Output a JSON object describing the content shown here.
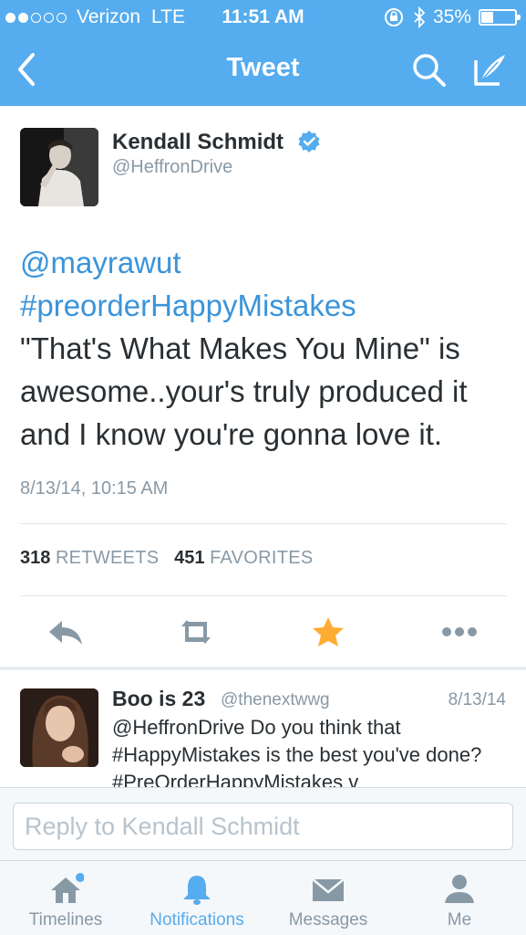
{
  "status_bar": {
    "carrier": "Verizon",
    "network": "LTE",
    "time": "11:51 AM",
    "battery_percent": "35%",
    "battery_level": 0.35,
    "signal_bars_filled": 2,
    "signal_bars_total": 5
  },
  "nav": {
    "title": "Tweet",
    "back_icon": "chevron-left-icon",
    "search_icon": "search-icon",
    "compose_icon": "compose-icon"
  },
  "tweet": {
    "author_name": "Kendall Schmidt",
    "author_handle": "@HeffronDrive",
    "verified": true,
    "mention": "@mayrawut",
    "hashtag": "#preorderHappyMistakes",
    "body": "\"That's What Makes You Mine\" is awesome..your's truly produced it and I know you're gonna love it.",
    "timestamp": "8/13/14, 10:15 AM",
    "retweets_count": "318",
    "retweets_label": "RETWEETS",
    "favorites_count": "451",
    "favorites_label": "FAVORITES"
  },
  "actions": [
    {
      "name": "reply",
      "icon": "reply-icon"
    },
    {
      "name": "retweet",
      "icon": "retweet-icon"
    },
    {
      "name": "favorite",
      "icon": "star-icon",
      "active": true
    },
    {
      "name": "more",
      "icon": "more-icon"
    }
  ],
  "reply": {
    "name": "Boo is 23",
    "handle": "@thenextwwg",
    "date": "8/13/14",
    "text": "@HeffronDrive Do you think that #HappyMistakes is the best you've done? #PreOrderHappyMistakes v"
  },
  "reply_box": {
    "placeholder": "Reply to Kendall Schmidt"
  },
  "tabs": [
    {
      "label": "Timelines",
      "icon": "home-icon",
      "active": false,
      "badge": true
    },
    {
      "label": "Notifications",
      "icon": "bell-icon",
      "active": true
    },
    {
      "label": "Messages",
      "icon": "envelope-icon",
      "active": false
    },
    {
      "label": "Me",
      "icon": "person-icon",
      "active": false
    }
  ],
  "colors": {
    "header": "#55acee",
    "link": "#3b94d9",
    "favorite": "#ffac33",
    "muted": "#8899a6"
  }
}
